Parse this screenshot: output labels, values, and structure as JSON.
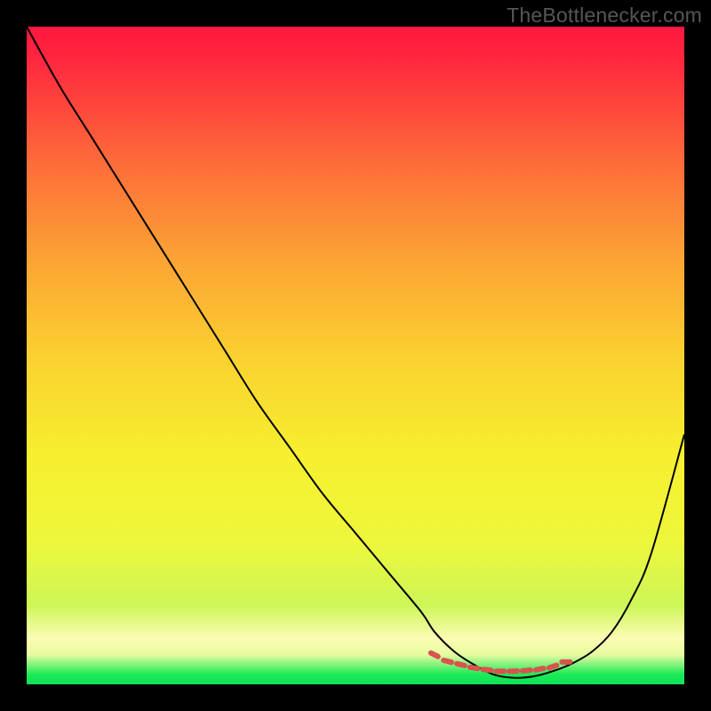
{
  "watermark": "TheBottlenecker.com",
  "chart_data": {
    "type": "line",
    "title": "",
    "xlabel": "",
    "ylabel": "",
    "xlim": [
      0,
      100
    ],
    "ylim": [
      0,
      100
    ],
    "grid": false,
    "background_gradient": {
      "stops": [
        {
          "offset": 0.0,
          "color": "#ff173f"
        },
        {
          "offset": 0.06,
          "color": "#ff2b3e"
        },
        {
          "offset": 0.2,
          "color": "#fd693a"
        },
        {
          "offset": 0.35,
          "color": "#fca235"
        },
        {
          "offset": 0.5,
          "color": "#fad030"
        },
        {
          "offset": 0.65,
          "color": "#f6ef2f"
        },
        {
          "offset": 0.78,
          "color": "#eef73b"
        },
        {
          "offset": 0.88,
          "color": "#cdf658"
        },
        {
          "offset": 0.93,
          "color": "#fbfcb3"
        },
        {
          "offset": 0.955,
          "color": "#e8fba0"
        },
        {
          "offset": 0.985,
          "color": "#1bea57"
        },
        {
          "offset": 1.0,
          "color": "#0fe357"
        }
      ]
    },
    "series": [
      {
        "name": "curve",
        "color": "#000000",
        "width": 2,
        "x": [
          0,
          5,
          10,
          15,
          20,
          25,
          30,
          35,
          40,
          45,
          50,
          55,
          60,
          62,
          65,
          68,
          71,
          74,
          77,
          80,
          83,
          86,
          89,
          92,
          95,
          100
        ],
        "y": [
          100,
          91,
          83,
          75,
          67,
          59,
          51,
          43,
          36,
          29,
          23,
          17,
          11,
          8,
          5,
          3,
          1.5,
          1,
          1.2,
          2,
          3.2,
          5,
          8,
          13,
          20,
          38
        ]
      },
      {
        "name": "marker-band",
        "color": "#d9534f",
        "style": "dotted",
        "width": 6,
        "x": [
          62,
          64,
          66,
          68,
          70,
          72,
          74,
          76,
          78,
          80,
          82
        ],
        "y": [
          4.5,
          3.5,
          3.0,
          2.5,
          2.2,
          2.0,
          2.0,
          2.1,
          2.3,
          2.7,
          3.4
        ]
      }
    ]
  }
}
